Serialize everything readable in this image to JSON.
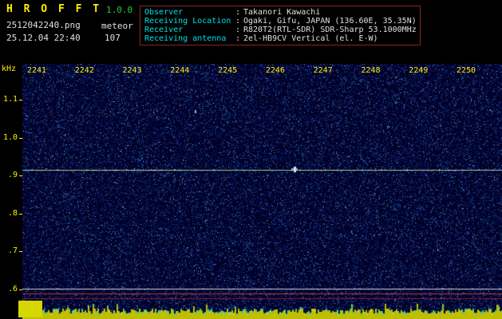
{
  "header": {
    "app_title": "H R O F F T",
    "version": "1.0.0",
    "filename": "2512042240.png",
    "mode": "meteor",
    "datetime": "25.12.04 22:40",
    "count": "107",
    "colon": ":",
    "info": [
      {
        "label": "Observer",
        "value": "Takanori Kawachi"
      },
      {
        "label": "Receiving Location",
        "value": "Ogaki, Gifu, JAPAN (136.60E, 35.35N)"
      },
      {
        "label": "Receiver",
        "value": "R820T2(RTL-SDR) SDR-Sharp 53.1000MHz"
      },
      {
        "label": "Receiving antenna",
        "value": "2el-HB9CV Vertical (el. E-W)"
      }
    ]
  },
  "chart_data": {
    "type": "heatmap",
    "title": "HROFFT radio meteor observation spectrogram",
    "xlabel": "",
    "ylabel": "kHz",
    "x_ticks": [
      "2241",
      "2242",
      "2243",
      "2244",
      "2245",
      "2246",
      "2247",
      "2248",
      "2249",
      "2250"
    ],
    "y_ticks": [
      "1.1",
      "1.0",
      ".9",
      ".8",
      ".7",
      ".6"
    ],
    "y_tick_khz": [
      1.1,
      1.0,
      0.9,
      0.8,
      0.7,
      0.6
    ],
    "x_range_hhmm": [
      "2240",
      "2250"
    ],
    "carrier_line_khz": 0.91,
    "reference_lines": [
      {
        "khz": 0.6,
        "color": "#e1e1e1"
      },
      {
        "khz": 0.587,
        "color": "#cd3737"
      },
      {
        "khz": 0.574,
        "color": "#912323"
      }
    ],
    "bottom_band": "signal-strength bars vs time",
    "grid": false,
    "legend_position": "none",
    "colors": {
      "background": "#000026",
      "axis_text": "#ffee00",
      "carrier_line": "#bcd787",
      "bars_yellow": "#c8c800",
      "bars_cyan": "#00cdcd",
      "info_label": "#00e0e0",
      "info_value": "#e0e0e0",
      "title_yellow": "#ffee00",
      "version_green": "#22cc44",
      "info_box_border": "#8b2424"
    }
  }
}
